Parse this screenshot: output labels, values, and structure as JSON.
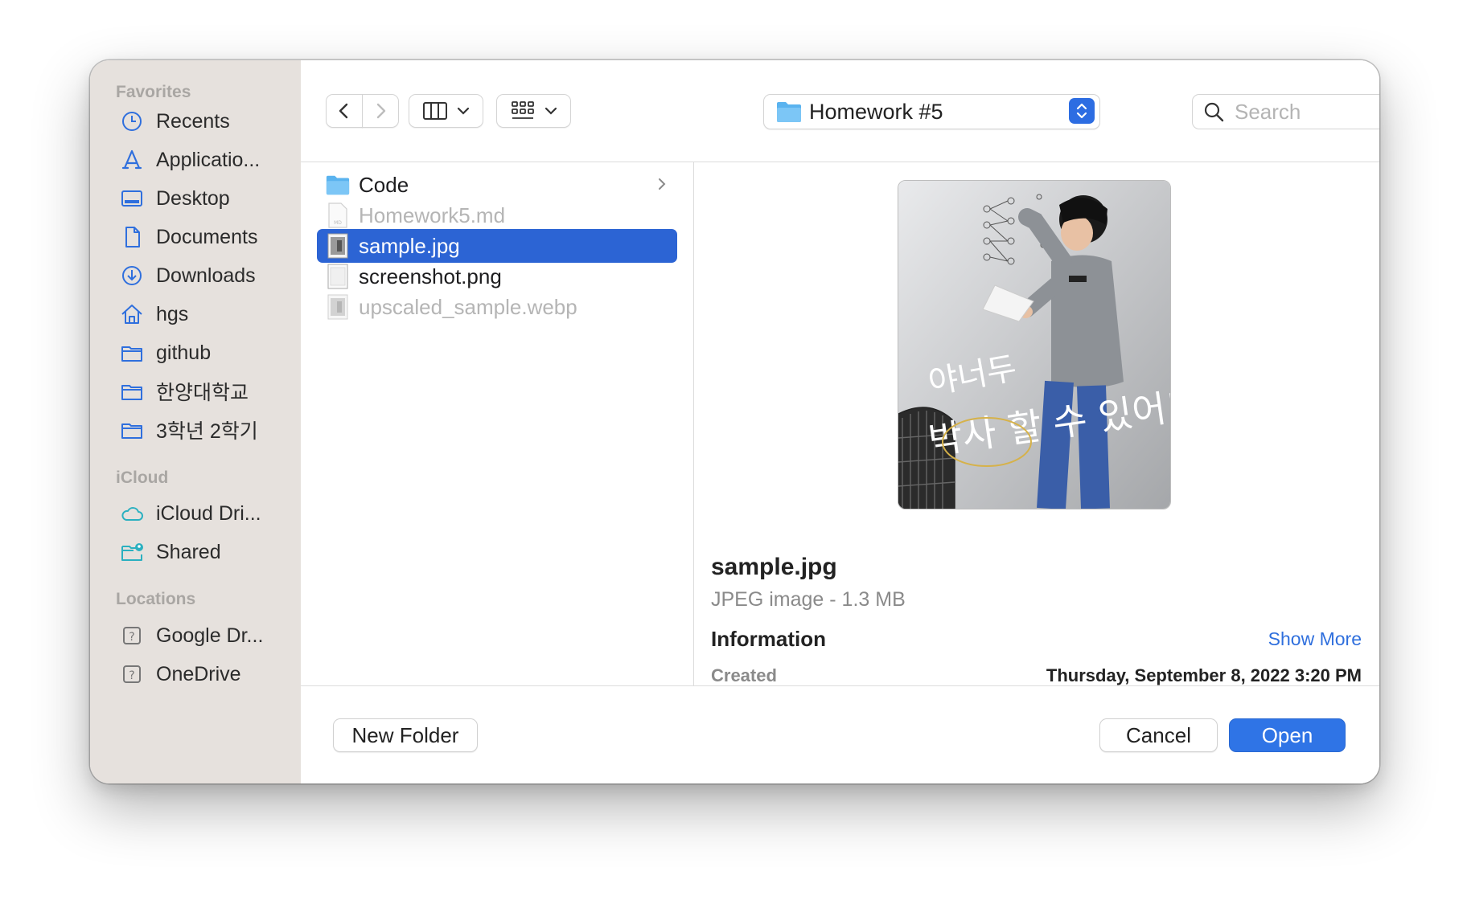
{
  "sidebar": {
    "sections": [
      {
        "title": "Favorites",
        "items": [
          {
            "label": "Recents",
            "icon": "clock-icon"
          },
          {
            "label": "Applicatio...",
            "icon": "applications-icon"
          },
          {
            "label": "Desktop",
            "icon": "desktop-icon"
          },
          {
            "label": "Documents",
            "icon": "document-icon"
          },
          {
            "label": "Downloads",
            "icon": "download-icon"
          },
          {
            "label": "hgs",
            "icon": "home-icon"
          },
          {
            "label": "github",
            "icon": "folder-icon"
          },
          {
            "label": "한양대학교",
            "icon": "folder-icon"
          },
          {
            "label": "3학년 2학기",
            "icon": "folder-icon"
          }
        ]
      },
      {
        "title": "iCloud",
        "items": [
          {
            "label": "iCloud Dri...",
            "icon": "cloud-icon"
          },
          {
            "label": "Shared",
            "icon": "shared-folder-icon"
          }
        ]
      },
      {
        "title": "Locations",
        "items": [
          {
            "label": "Google Dr...",
            "icon": "unknown-drive-icon"
          },
          {
            "label": "OneDrive",
            "icon": "unknown-drive-icon"
          }
        ]
      }
    ]
  },
  "toolbar": {
    "path_label": "Homework #5",
    "search_placeholder": "Search"
  },
  "files": [
    {
      "name": "Code",
      "kind": "folder",
      "state": "normal",
      "has_children": true
    },
    {
      "name": "Homework5.md",
      "kind": "md",
      "state": "dim"
    },
    {
      "name": "sample.jpg",
      "kind": "image",
      "state": "selected"
    },
    {
      "name": "screenshot.png",
      "kind": "png",
      "state": "normal"
    },
    {
      "name": "upscaled_sample.webp",
      "kind": "image",
      "state": "dim"
    }
  ],
  "preview": {
    "image_text_line1": "야너두",
    "image_text_line2": "박사 할 수 있어!",
    "name": "sample.jpg",
    "kind": "JPEG image - 1.3 MB",
    "info_heading": "Information",
    "show_more": "Show More",
    "created_label": "Created",
    "created_value": "Thursday, September 8, 2022 3:20 PM"
  },
  "buttons": {
    "new_folder": "New Folder",
    "cancel": "Cancel",
    "open": "Open"
  },
  "colors": {
    "accent": "#2f74e6",
    "selection": "#2c64d4",
    "sidebar_bg": "#e6e1dd",
    "sidebar_icon": "#2f6fdd"
  }
}
